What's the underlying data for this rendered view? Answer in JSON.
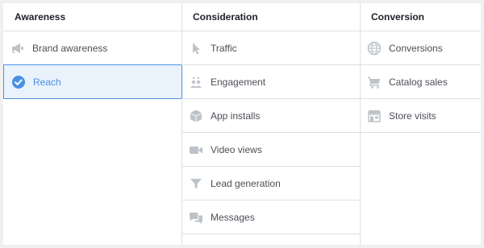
{
  "colors": {
    "accent": "#4a90e2",
    "selected_bg": "#eaf3fc",
    "icon_gray": "#bec3c9",
    "text": "#4b4f56",
    "heading": "#1d2129",
    "border": "#dddfe2"
  },
  "columns": [
    {
      "heading": "Awareness",
      "items": [
        {
          "label": "Brand awareness",
          "icon": "megaphone-icon",
          "selected": false
        },
        {
          "label": "Reach",
          "icon": "checkmark-circle-icon",
          "selected": true
        }
      ]
    },
    {
      "heading": "Consideration",
      "items": [
        {
          "label": "Traffic",
          "icon": "cursor-icon",
          "selected": false
        },
        {
          "label": "Engagement",
          "icon": "people-icon",
          "selected": false
        },
        {
          "label": "App installs",
          "icon": "box-icon",
          "selected": false
        },
        {
          "label": "Video views",
          "icon": "video-camera-icon",
          "selected": false
        },
        {
          "label": "Lead generation",
          "icon": "funnel-icon",
          "selected": false
        },
        {
          "label": "Messages",
          "icon": "chat-bubbles-icon",
          "selected": false
        }
      ]
    },
    {
      "heading": "Conversion",
      "items": [
        {
          "label": "Conversions",
          "icon": "globe-icon",
          "selected": false
        },
        {
          "label": "Catalog sales",
          "icon": "shopping-cart-icon",
          "selected": false
        },
        {
          "label": "Store visits",
          "icon": "storefront-icon",
          "selected": false
        }
      ]
    }
  ]
}
